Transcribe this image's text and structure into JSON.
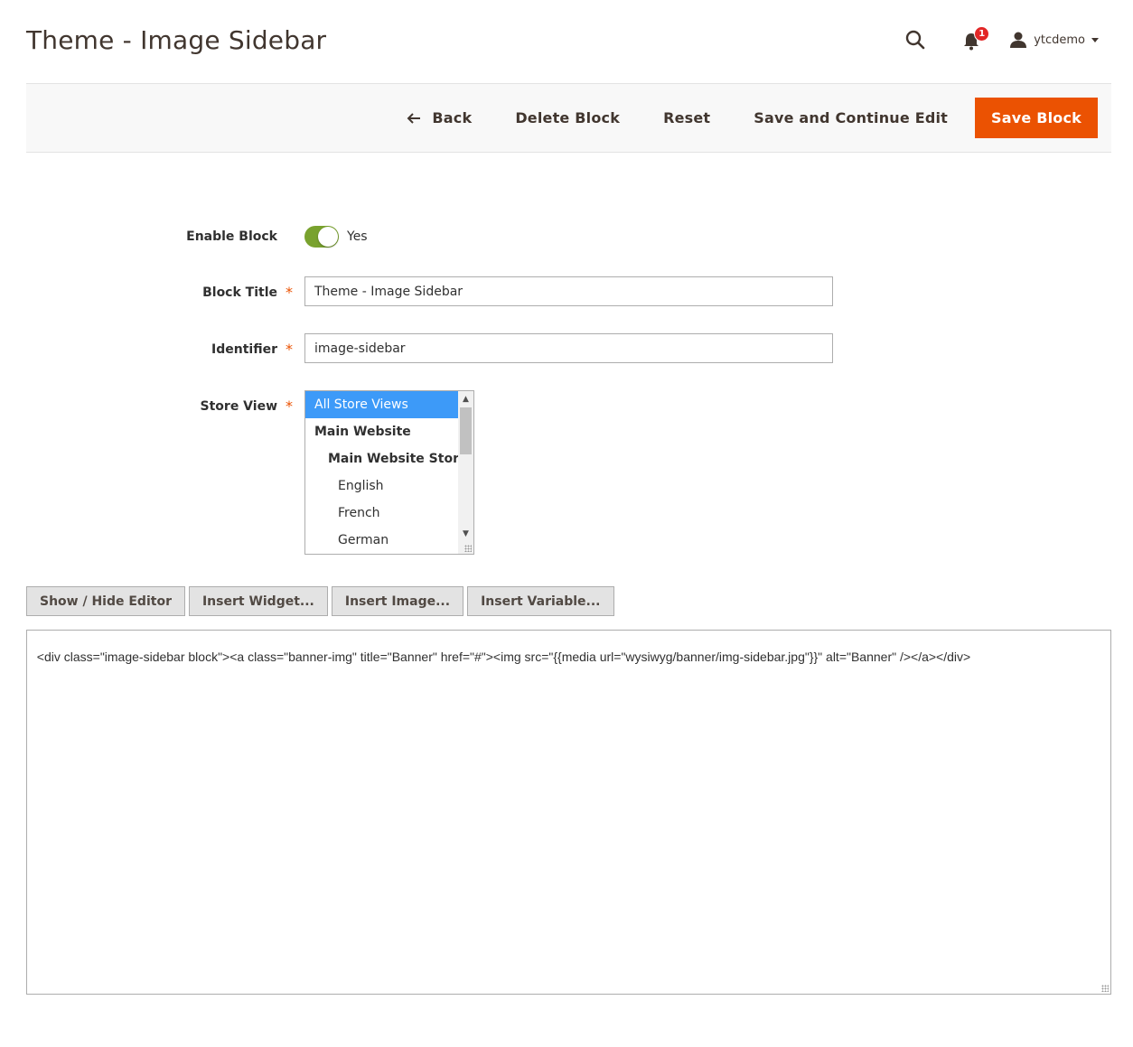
{
  "page": {
    "title": "Theme - Image Sidebar"
  },
  "header": {
    "notifications_count": "1",
    "user_name": "ytcdemo"
  },
  "toolbar": {
    "back_label": "Back",
    "delete_label": "Delete Block",
    "reset_label": "Reset",
    "save_continue_label": "Save and Continue Edit",
    "save_label": "Save Block"
  },
  "form": {
    "enable_block": {
      "label": "Enable Block",
      "value": "Yes"
    },
    "block_title": {
      "label": "Block Title",
      "value": "Theme - Image Sidebar"
    },
    "identifier": {
      "label": "Identifier",
      "value": "image-sidebar"
    },
    "store_view": {
      "label": "Store View",
      "options": [
        "All Store Views",
        "Main Website",
        "Main Website Store",
        "English",
        "French",
        "German"
      ]
    }
  },
  "editor": {
    "buttons": [
      "Show / Hide Editor",
      "Insert Widget...",
      "Insert Image...",
      "Insert Variable..."
    ],
    "content": "<div class=\"image-sidebar block\"><a class=\"banner-img\" title=\"Banner\" href=\"#\"><img src=\"{{media url=\"wysiwyg/banner/img-sidebar.jpg\"}}\" alt=\"Banner\" /></a></div>"
  },
  "colors": {
    "primary": "#eb5202",
    "toggle_on": "#79a22e",
    "selected_option": "#3d9af8",
    "badge": "#e22626"
  },
  "icons": [
    "search-icon",
    "bell-icon",
    "user-icon",
    "caret-down-icon",
    "arrow-left-icon"
  ]
}
